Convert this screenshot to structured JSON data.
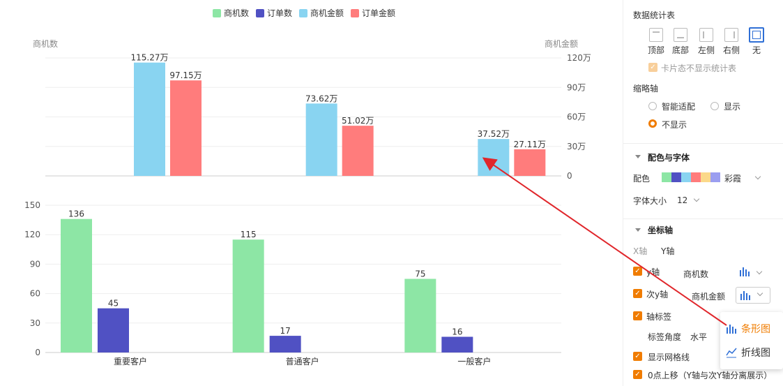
{
  "chart_data": [
    {
      "type": "bar",
      "categories": [
        "重要客户",
        "普通客户",
        "一般客户"
      ],
      "series": [
        {
          "name": "商机金额",
          "values": [
            115.27,
            73.62,
            37.52
          ],
          "labels": [
            "115.27万",
            "73.62万",
            "37.52万"
          ],
          "color": "#89d4f1"
        },
        {
          "name": "订单金额",
          "values": [
            97.15,
            51.02,
            27.11
          ],
          "labels": [
            "97.15万",
            "51.02万",
            "27.11万"
          ],
          "color": "#ff7c7c"
        }
      ],
      "ylabel": "商机金额",
      "ylim": [
        0,
        120
      ],
      "yticks": [
        "120万",
        "90万",
        "60万",
        "30万",
        "0"
      ],
      "grid": true
    },
    {
      "type": "bar",
      "categories": [
        "重要客户",
        "普通客户",
        "一般客户"
      ],
      "series": [
        {
          "name": "商机数",
          "values": [
            136,
            115,
            75
          ],
          "labels": [
            "136",
            "115",
            "75"
          ],
          "color": "#8de6a5"
        },
        {
          "name": "订单数",
          "values": [
            45,
            17,
            16
          ],
          "labels": [
            "45",
            "17",
            "16"
          ],
          "color": "#5051c3"
        }
      ],
      "ylabel": "商机数",
      "ylim": [
        0,
        150
      ],
      "yticks": [
        "150",
        "120",
        "90",
        "60",
        "30",
        "0"
      ],
      "grid": true
    }
  ],
  "legend": [
    {
      "name": "商机数",
      "color": "#8de6a5"
    },
    {
      "name": "订单数",
      "color": "#5051c3"
    },
    {
      "name": "商机金额",
      "color": "#89d4f1"
    },
    {
      "name": "订单金额",
      "color": "#ff7c7c"
    }
  ],
  "axis_names": {
    "left": "商机数",
    "right": "商机金额"
  },
  "colors": {
    "accent": "#f07c00",
    "arrow": "#e0262b",
    "selected_border": "#2f6fd6"
  },
  "panel": {
    "stats_table": {
      "title": "数据统计表",
      "positions": [
        "顶部",
        "底部",
        "左侧",
        "右侧",
        "无"
      ],
      "selected": "无",
      "card_hide": "卡片态不显示统计表"
    },
    "thumb_axis": {
      "title": "缩略轴",
      "options": [
        "智能适配",
        "显示",
        "不显示"
      ],
      "selected": "不显示"
    },
    "color_font": {
      "title": "配色与字体",
      "palette_label": "配色",
      "palette_name": "彩霞",
      "palette_colors": [
        "#8de6a5",
        "#5051c3",
        "#89d4f1",
        "#ff7c7c",
        "#fbd98a",
        "#9b9ef0"
      ],
      "font_size_label": "字体大小",
      "font_size": "12"
    },
    "axis": {
      "title": "坐标轴",
      "tab_x": "X轴",
      "tab_y": "Y轴",
      "y_axis_label": "y轴",
      "y_axis_field": "商机数",
      "y2_axis_label": "次y轴",
      "y2_axis_field": "商机金额",
      "axis_tag": "轴标签",
      "tag_angle_label": "标签角度",
      "tag_angle": "水平",
      "show_grid": "显示网格线",
      "zero_move": "0点上移（Y轴与次Y轴分离展示）"
    },
    "popup": {
      "bar": "条形图",
      "line": "折线图"
    }
  }
}
